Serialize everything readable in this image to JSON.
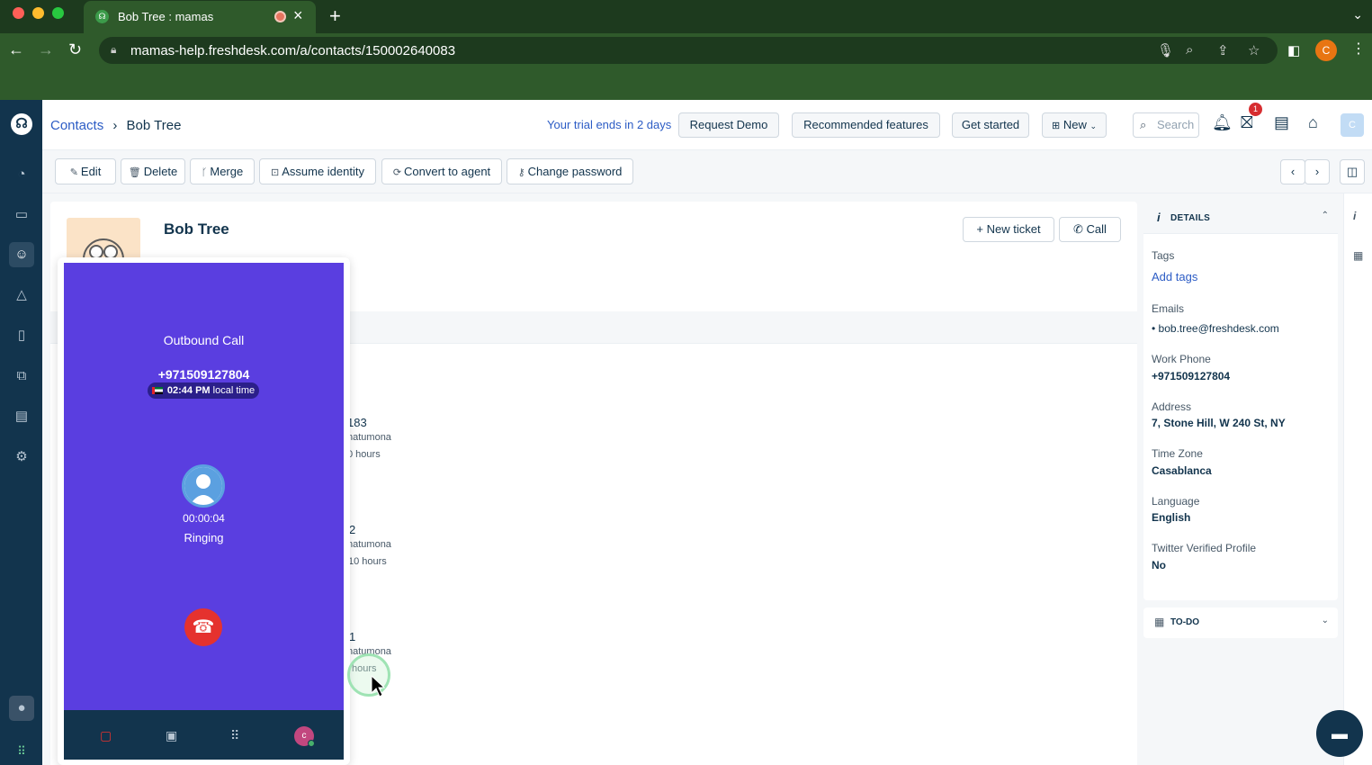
{
  "browser": {
    "tab_title": "Bob Tree : mamas",
    "url": "mamas-help.freshdesk.com/a/contacts/150002640083",
    "profile_initial": "C"
  },
  "header": {
    "breadcrumb_parent": "Contacts",
    "breadcrumb_current": "Bob Tree",
    "trial_text": "Your trial ends in 2 days",
    "request_demo": "Request Demo",
    "recommended": "Recommended features",
    "get_started": "Get started",
    "new_label": "New",
    "search_placeholder": "Search",
    "notification_count": "1",
    "avatar_initial": "C"
  },
  "toolbar": {
    "edit": "Edit",
    "delete": "Delete",
    "merge": "Merge",
    "assume_identity": "Assume identity",
    "convert_to_agent": "Convert to agent",
    "change_password": "Change password"
  },
  "contact": {
    "name": "Bob Tree",
    "new_ticket": "New ticket",
    "call": "Call"
  },
  "activities": [
    {
      "id": "183",
      "by": "natumona",
      "when": "0 hours"
    },
    {
      "id": "2",
      "by": "natumona",
      "when": "10 hours"
    },
    {
      "id": "1",
      "by": "natumona",
      "when": "hours"
    }
  ],
  "call_widget": {
    "type": "Outbound Call",
    "number": "+971509127804",
    "local_time": "02:44 PM",
    "local_time_suffix": "local time",
    "timer": "00:00:04",
    "status": "Ringing",
    "agent_initial": "c"
  },
  "details": {
    "title": "DETAILS",
    "tags_label": "Tags",
    "add_tags": "Add tags",
    "emails_label": "Emails",
    "email": "bob.tree@freshdesk.com",
    "work_phone_label": "Work Phone",
    "work_phone": "+971509127804",
    "address_label": "Address",
    "address": "7, Stone Hill, W 240 St, NY",
    "timezone_label": "Time Zone",
    "timezone": "Casablanca",
    "language_label": "Language",
    "language": "English",
    "twitter_label": "Twitter Verified Profile",
    "twitter": "No",
    "todo_title": "TO-DO"
  },
  "colors": {
    "brand_dark": "#12344d",
    "call_purple": "#5a3ee0",
    "link_blue": "#2c5cc5",
    "browser_green": "#2f5a2b"
  }
}
